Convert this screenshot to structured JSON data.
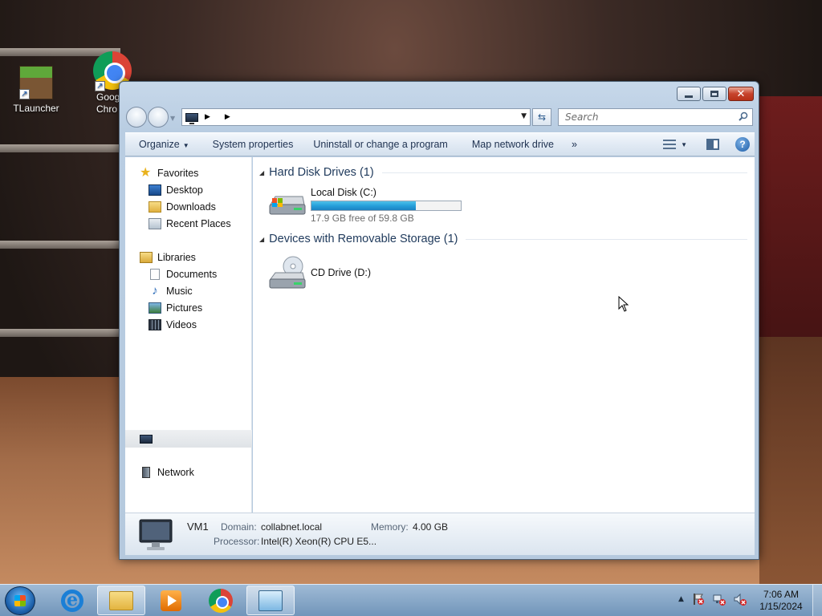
{
  "desktop": {
    "icons": [
      {
        "label": "TLauncher"
      },
      {
        "label_line1": "Goog",
        "label_line2": "Chro"
      }
    ]
  },
  "window": {
    "address": {
      "segments": [
        "",
        ""
      ]
    },
    "search": {
      "placeholder": "Search"
    },
    "command_bar": {
      "organize": "Organize",
      "system_properties": "System properties",
      "uninstall": "Uninstall or change a program",
      "map_drive": "Map network drive",
      "more": "»"
    },
    "nav": {
      "favorites": "Favorites",
      "desktop": "Desktop",
      "downloads": "Downloads",
      "recent_places": "Recent Places",
      "libraries": "Libraries",
      "documents": "Documents",
      "music": "Music",
      "pictures": "Pictures",
      "videos": "Videos",
      "network": "Network"
    },
    "groups": {
      "hdd": {
        "title": "Hard Disk Drives (1)",
        "drives": [
          {
            "name": "Local Disk (C:)",
            "free_text": "17.9 GB free of 59.8 GB",
            "used_fraction": 0.7
          }
        ]
      },
      "removable": {
        "title": "Devices with Removable Storage (1)",
        "drives": [
          {
            "name": "CD Drive (D:)"
          }
        ]
      }
    },
    "details": {
      "computer_name": "VM1",
      "domain_label": "Domain:",
      "domain_value": "collabnet.local",
      "memory_label": "Memory:",
      "memory_value": "4.00 GB",
      "processor_label": "Processor:",
      "processor_value": "Intel(R) Xeon(R) CPU E5..."
    }
  },
  "taskbar": {
    "clock": {
      "time": "7:06 AM",
      "date": "1/15/2024"
    },
    "tray_expand": "▲"
  },
  "colors": {
    "accent": "#1e395b",
    "progress": "#26a0da"
  }
}
